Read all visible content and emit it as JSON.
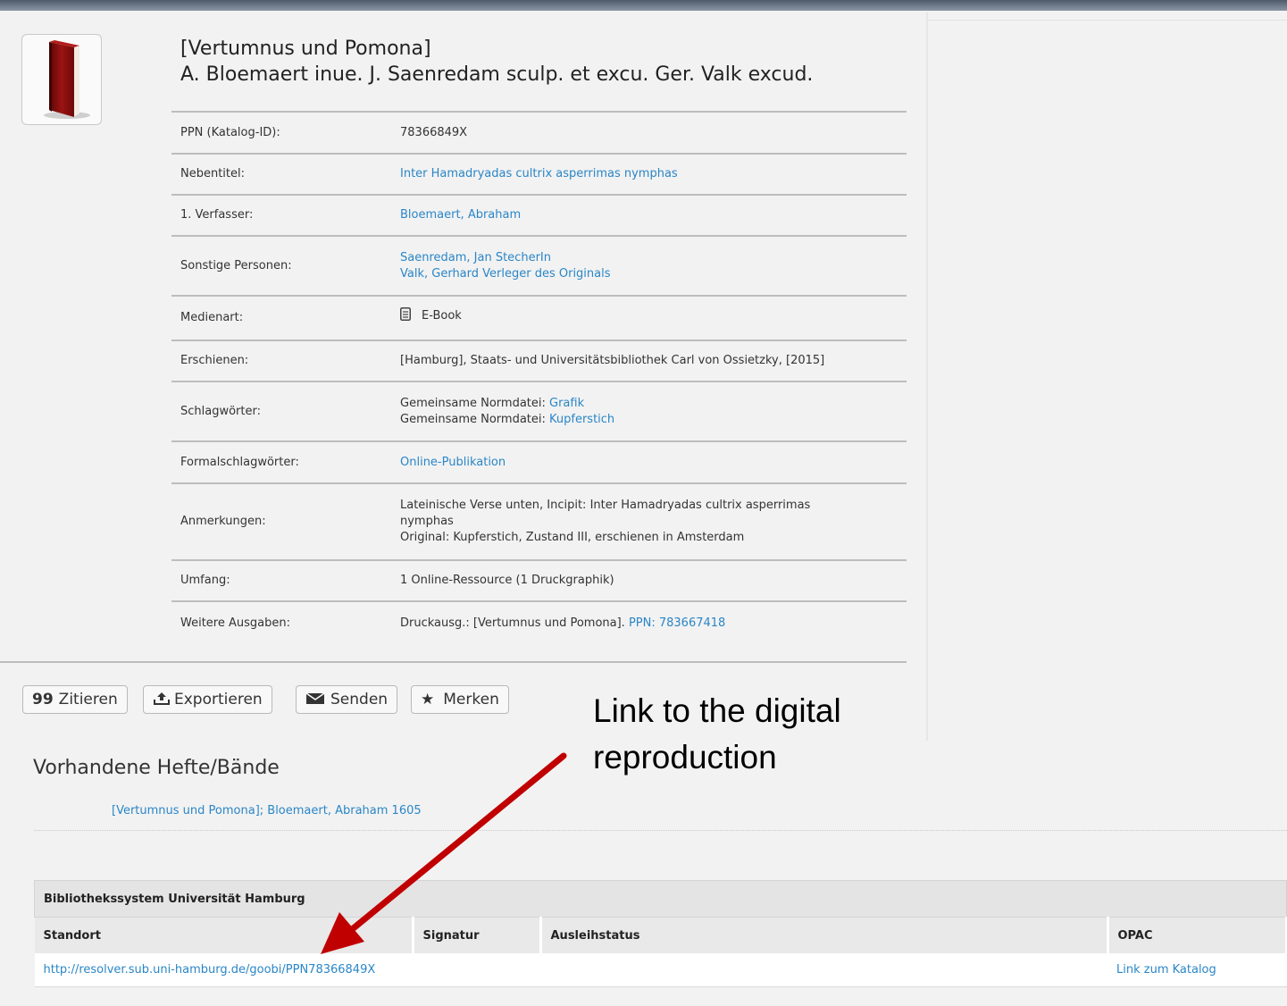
{
  "record": {
    "title_line1": "[Vertumnus und Pomona]",
    "title_line2": "A. Bloemaert inue. J. Saenredam sculp. et excu. Ger. Valk excud.",
    "fields": {
      "ppn_label": "PPN (Katalog-ID):",
      "ppn_value": "78366849X",
      "nebentitel_label": "Nebentitel:",
      "nebentitel_value": "Inter Hamadryadas cultrix asperrimas nymphas",
      "verfasser_label": "1. Verfasser:",
      "verfasser_value": "Bloemaert, Abraham",
      "personen_label": "Sonstige Personen:",
      "personen_value_1": "Saenredam, Jan StecherIn",
      "personen_value_2": "Valk, Gerhard Verleger des Originals",
      "medienart_label": "Medienart:",
      "medienart_value": "E-Book",
      "erschienen_label": "Erschienen:",
      "erschienen_value": "[Hamburg], Staats- und Universitätsbibliothek Carl von Ossietzky, [2015]",
      "schlagwoerter_label": "Schlagwörter:",
      "schlag_prefix_1": "Gemeinsame Normdatei: ",
      "schlag_link_1": "Grafik",
      "schlag_prefix_2": "Gemeinsame Normdatei: ",
      "schlag_link_2": "Kupferstich",
      "formal_label": "Formalschlagwörter:",
      "formal_value": "Online-Publikation",
      "anmerkungen_label": "Anmerkungen:",
      "anmerkungen_value_1": "Lateinische Verse unten, Incipit: Inter Hamadryadas cultrix asperrimas",
      "anmerkungen_value_2": "nymphas",
      "anmerkungen_value_3": "Original: Kupferstich, Zustand III, erschienen in Amsterdam",
      "umfang_label": "Umfang:",
      "umfang_value": "1 Online-Ressource (1 Druckgraphik)",
      "ausgaben_label": "Weitere Ausgaben:",
      "ausgaben_prefix": "Druckausg.: [Vertumnus und Pomona]. ",
      "ausgaben_link": "PPN: 783667418"
    }
  },
  "actions": {
    "zitieren": "Zitieren",
    "exportieren": "Exportieren",
    "senden": "Senden",
    "merken": "Merken"
  },
  "annotation": {
    "line1": "Link to the digital",
    "line2": "reproduction",
    "arrow_color": "#c00000"
  },
  "volumes": {
    "heading": "Vorhandene Hefte/Bände",
    "item": "[Vertumnus und Pomona]; Bloemaert, Abraham 1605"
  },
  "holdings": {
    "system": "Bibliothekssystem Universität Hamburg",
    "columns": [
      "Standort",
      "Signatur",
      "Ausleihstatus",
      "OPAC"
    ],
    "row": {
      "standort": "http://resolver.sub.uni-hamburg.de/goobi/PPN78366849X",
      "signatur": "",
      "ausleihstatus": "",
      "opac": "Link zum Katalog"
    }
  },
  "icons": {
    "cover": "book-icon",
    "ebook": "ebook-icon",
    "cite": "quote-icon",
    "export": "upload-icon",
    "send": "envelope-icon",
    "bookmark": "star-icon"
  },
  "colors": {
    "link": "#2a86c7",
    "book_cover": "#8b0f0f"
  }
}
